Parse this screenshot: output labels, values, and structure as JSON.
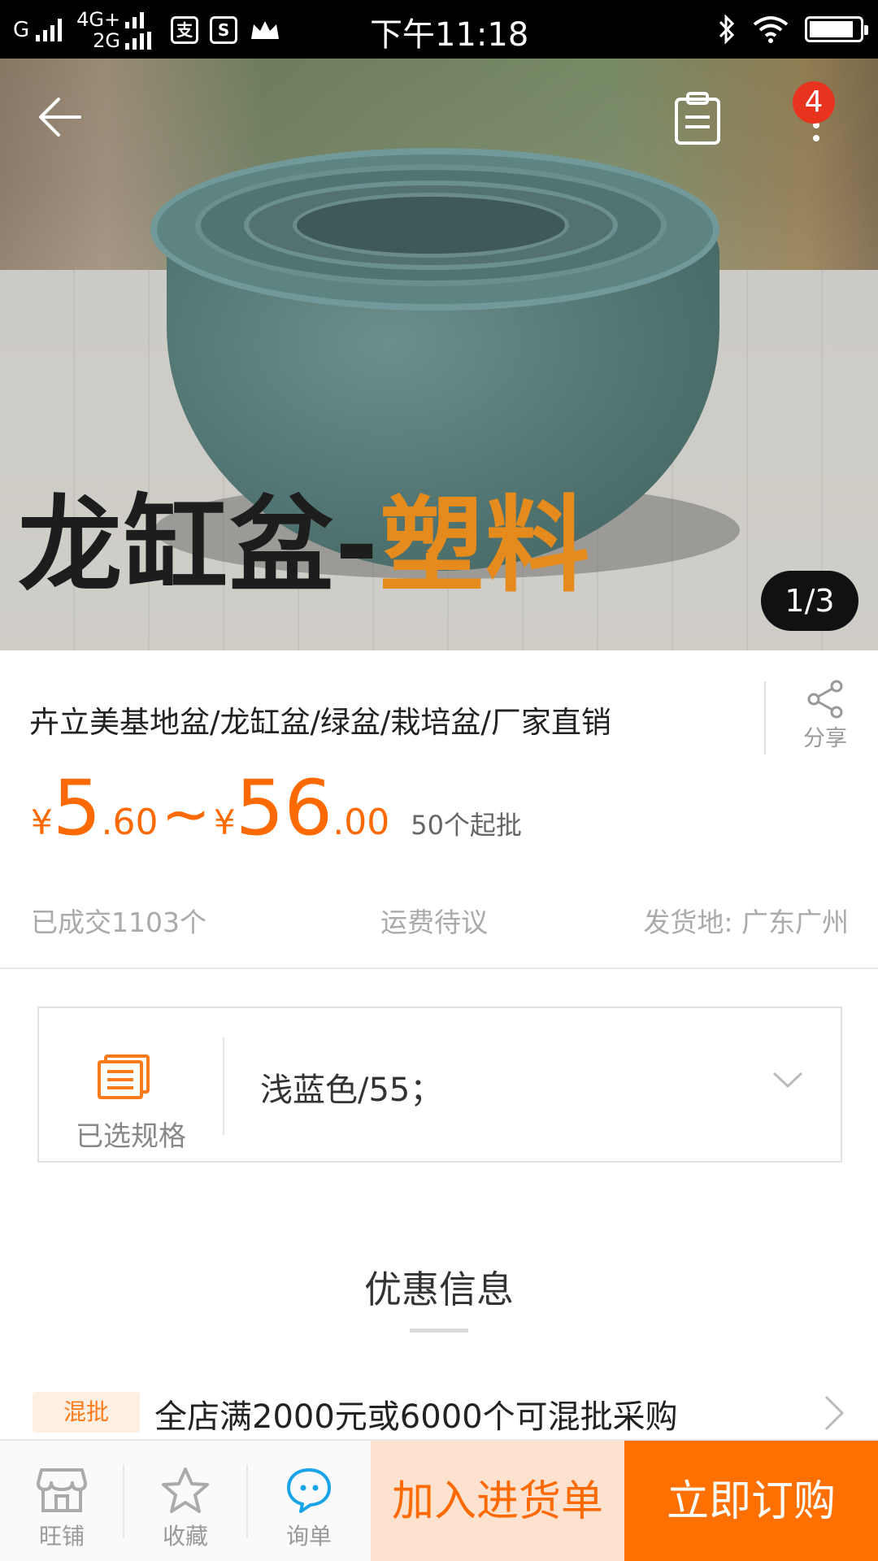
{
  "status_bar": {
    "carrier1": "G",
    "carrier2_top": "4G+",
    "carrier2_bottom": "2G",
    "app_icon_2": "S",
    "time": "下午11:18",
    "icons": [
      "signal-icon",
      "alipay-icon",
      "s-app-icon",
      "crown-icon",
      "bluetooth-icon",
      "wifi-icon",
      "battery-icon"
    ],
    "battery_level": 0.9
  },
  "hero": {
    "caption_part1": "龙缸盆-",
    "caption_part2": "塑料",
    "cart_badge": "4",
    "pager": "1/3"
  },
  "product": {
    "title": "卉立美基地盆/龙缸盆/绿盆/栽培盆/厂家直销",
    "share_label": "分享",
    "price_min_yen": "¥",
    "price_min_int": "5",
    "price_min_dec": ".60",
    "price_sep": "~",
    "price_max_yen": "¥",
    "price_max_int": "56",
    "price_max_dec": ".00",
    "moq": "50个起批",
    "sold": "已成交1103个",
    "shipping": "运费待议",
    "origin": "发货地: 广东广州"
  },
  "spec": {
    "label": "已选规格",
    "value": "浅蓝色/55；"
  },
  "promotions": {
    "title": "优惠信息",
    "items": [
      {
        "tag": "混批",
        "text": "全店满2000元或6000个可混批采购"
      }
    ]
  },
  "bottom_bar": {
    "shop": "旺铺",
    "favorite": "收藏",
    "inquiry": "询单",
    "add_to_list": "加入进货单",
    "buy_now": "立即订购"
  },
  "colors": {
    "accent": "#ff6a00",
    "buy_button": "#ff7000",
    "cart_button_bg": "#fde3cf",
    "badge": "#e8331f",
    "inquiry_icon": "#1aa4e8"
  }
}
